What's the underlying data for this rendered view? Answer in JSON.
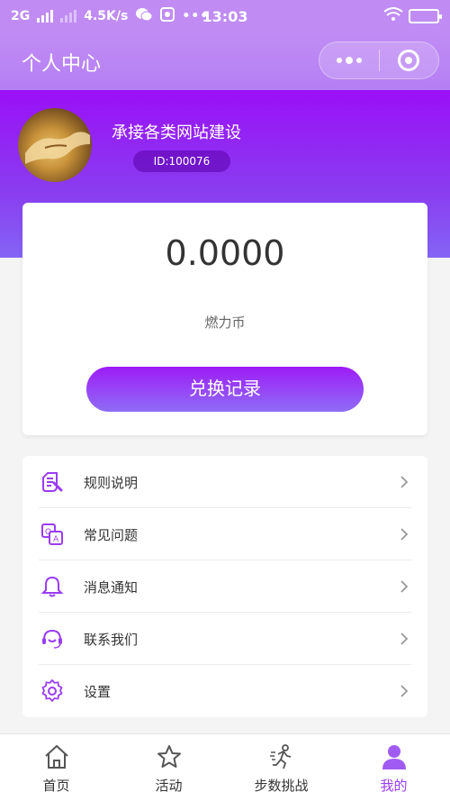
{
  "status_bar": {
    "network": "2G",
    "speed": "4.5K/s",
    "time": "13:03"
  },
  "nav": {
    "title": "个人中心"
  },
  "profile": {
    "username": "承接各类网站建设",
    "id_text": "ID:100076"
  },
  "balance": {
    "value": "0.0000",
    "unit": "燃力币",
    "exchange_label": "兑换记录"
  },
  "menu": {
    "items": [
      {
        "label": "规则说明",
        "icon": "rules-icon"
      },
      {
        "label": "常见问题",
        "icon": "faq-icon"
      },
      {
        "label": "消息通知",
        "icon": "bell-icon"
      },
      {
        "label": "联系我们",
        "icon": "headset-icon"
      },
      {
        "label": "设置",
        "icon": "gear-icon"
      }
    ]
  },
  "tabbar": {
    "items": [
      {
        "label": "首页",
        "icon": "home-icon"
      },
      {
        "label": "活动",
        "icon": "star-icon"
      },
      {
        "label": "步数挑战",
        "icon": "runner-icon"
      },
      {
        "label": "我的",
        "icon": "user-icon",
        "active": true
      }
    ]
  },
  "colors": {
    "accent": "#9b3cf3",
    "header_top": "#9a10f7",
    "status_bar": "#c08cf3"
  }
}
